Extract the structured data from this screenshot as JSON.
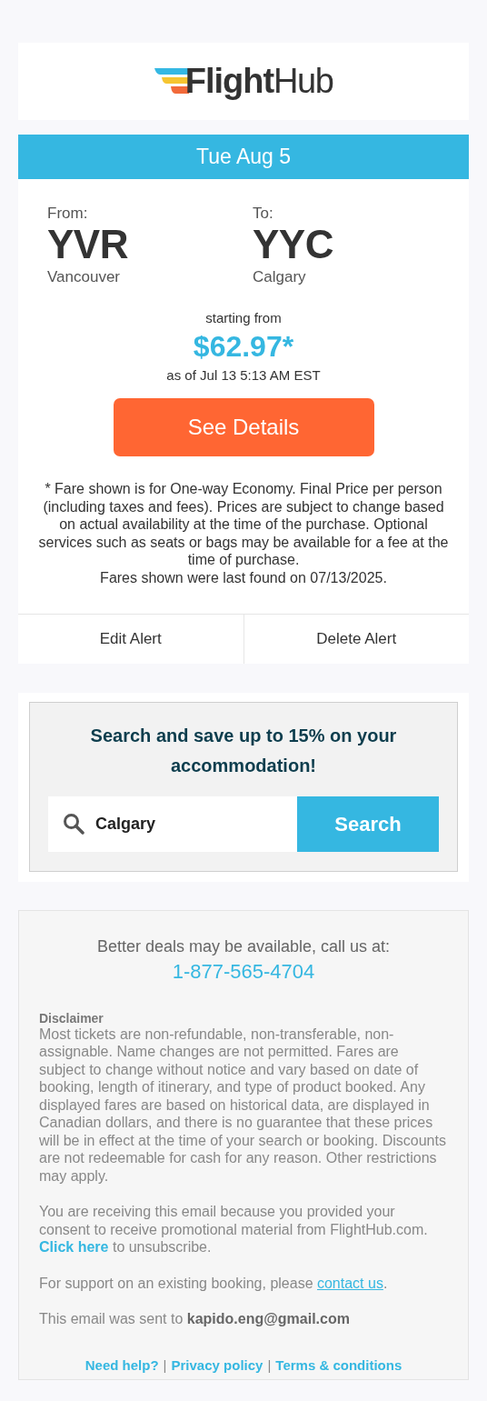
{
  "logo": {
    "bold": "Flight",
    "light": "Hub"
  },
  "alert": {
    "date": "Tue Aug 5",
    "route": [
      {
        "label": "From:",
        "code": "YVR",
        "city": "Vancouver"
      },
      {
        "label": "To:",
        "code": "YYC",
        "city": "Calgary"
      }
    ],
    "starting_label": "starting from",
    "price": "$62.97*",
    "as_of": "as of Jul 13 5:13 AM EST",
    "button": "See Details",
    "fine_print": "* Fare shown is for One-way Economy. Final Price per person (including taxes and fees). Prices are subject to change based on actual availability at the time of the purchase. Optional services such as seats or bags may be available for a fee at the time of purchase.",
    "last_found": "Fares shown were last found on 07/13/2025.",
    "actions": [
      "Edit Alert",
      "Delete Alert"
    ]
  },
  "promo": {
    "heading": "Search and save up to 15% on your accommodation!",
    "search_value": "Calgary",
    "search_button": "Search"
  },
  "footer": {
    "call_text": "Better deals may be available, call us at:",
    "phone": "1-877-565-4704",
    "disclaimer_title": "Disclaimer",
    "disclaimer": "Most tickets are non-refundable, non-transferable, non-assignable. Name changes are not permitted. Fares are subject to change without notice and vary based on date of booking, length of itinerary, and type of product booked. Any displayed fares are based on historical data, are displayed in Canadian dollars, and there is no guarantee that these prices will be in effect at the time of your search or booking. Discounts are not redeemable for cash for any reason. Other restrictions may apply.",
    "consent": {
      "before": "You are receiving this email because you provided your consent to receive promotional material from FlightHub.com. ",
      "link": "Click here",
      "after": " to unsubscribe."
    },
    "support": {
      "before": "For support on an existing booking, please ",
      "link": "contact us",
      "after": "."
    },
    "sent_to": "This email was sent to **kapido.eng@gmail.com**",
    "links": [
      "Need help?",
      "Privacy policy",
      "Terms & conditions"
    ],
    "separators": [
      "|",
      "|"
    ]
  }
}
